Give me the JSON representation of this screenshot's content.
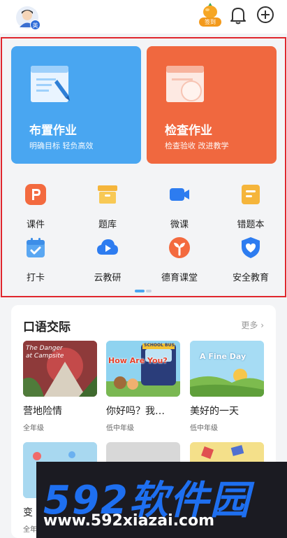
{
  "header": {
    "avatar_badge": "英",
    "signin_label": "签到"
  },
  "feature_cards": [
    {
      "title": "布置作业",
      "subtitle": "明确目标 轻负高效",
      "color": "#49a6f1"
    },
    {
      "title": "检查作业",
      "subtitle": "检查验收 改进教学",
      "color": "#f0683f"
    }
  ],
  "tools": [
    {
      "label": "课件",
      "icon": "courseware-icon"
    },
    {
      "label": "题库",
      "icon": "question-bank-icon"
    },
    {
      "label": "微课",
      "icon": "micro-lesson-icon"
    },
    {
      "label": "错题本",
      "icon": "mistake-book-icon"
    },
    {
      "label": "打卡",
      "icon": "check-in-icon"
    },
    {
      "label": "云教研",
      "icon": "cloud-research-icon"
    },
    {
      "label": "德育课堂",
      "icon": "moral-class-icon"
    },
    {
      "label": "安全教育",
      "icon": "safety-shield-icon"
    }
  ],
  "oral_section": {
    "title": "口语交际",
    "more": "更多 ›",
    "courses": [
      {
        "name": "营地险情",
        "grade": "全年级",
        "thumb_text": "The Danger at Campsite"
      },
      {
        "name": "你好吗？我…",
        "grade": "低中年级",
        "thumb_text": "How Are You?",
        "thumb_bus": "SCHOOL BUS"
      },
      {
        "name": "美好的一天",
        "grade": "低中年级",
        "thumb_text": "A Fine Day"
      },
      {
        "name": "变",
        "grade": "全年"
      }
    ]
  },
  "watermark": {
    "logo": "592软件园",
    "url": "www.592xiazai.com"
  }
}
